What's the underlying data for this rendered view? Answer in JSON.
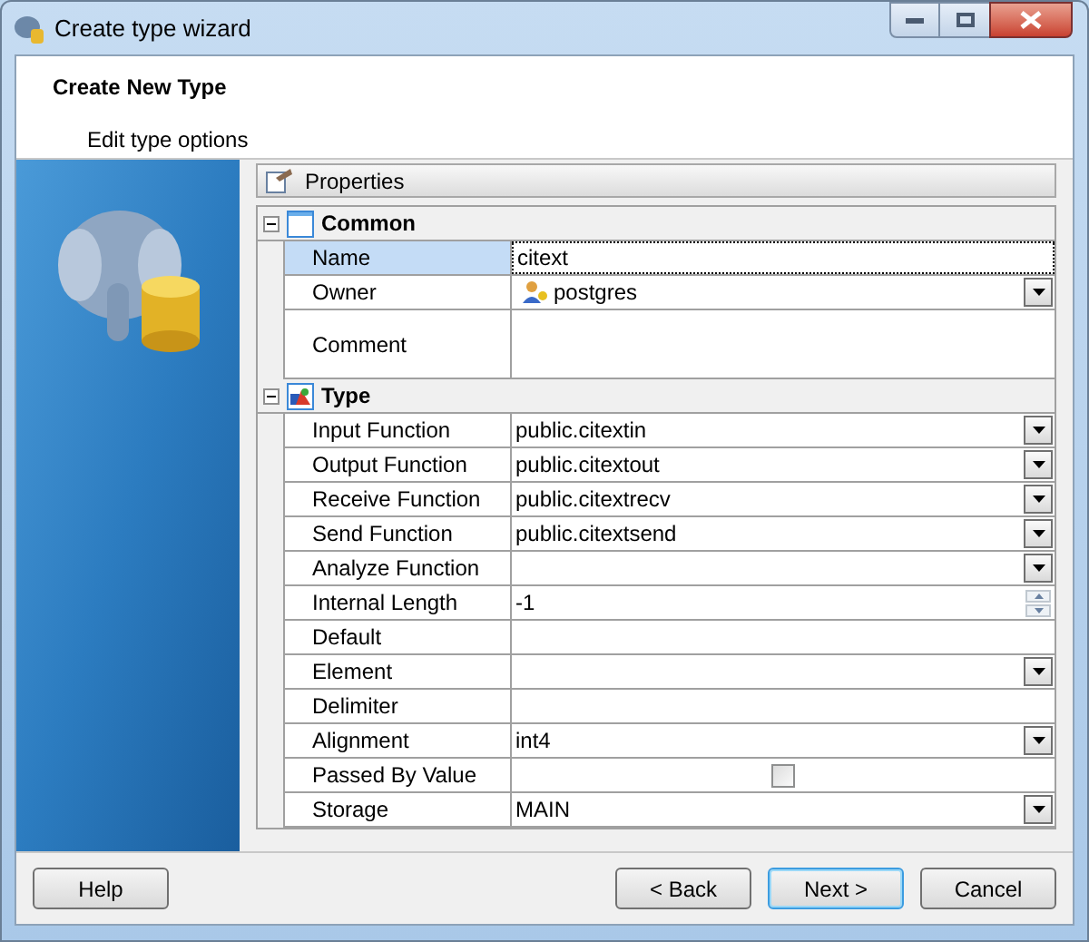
{
  "window": {
    "title": "Create type wizard"
  },
  "header": {
    "title": "Create New Type",
    "subtitle": "Edit type options"
  },
  "panel": {
    "title": "Properties"
  },
  "groups": [
    {
      "title": "Common",
      "expanded": true,
      "kind": "common",
      "rows": [
        {
          "label": "Name",
          "value": "citext",
          "kind": "text",
          "selected": true
        },
        {
          "label": "Owner",
          "value": "postgres",
          "kind": "owner",
          "selected": false
        },
        {
          "label": "Comment",
          "kind": "memo",
          "selected": false
        }
      ]
    },
    {
      "title": "Type",
      "expanded": true,
      "kind": "type",
      "rows": [
        {
          "label": "Input Function",
          "value": "public.citextin",
          "kind": "dropdown",
          "selected": false
        },
        {
          "label": "Output Function",
          "value": "public.citextout",
          "kind": "dropdown",
          "selected": false
        },
        {
          "label": "Receive Function",
          "value": "public.citextrecv",
          "kind": "dropdown",
          "selected": false
        },
        {
          "label": "Send Function",
          "value": "public.citextsend",
          "kind": "dropdown",
          "selected": false
        },
        {
          "label": "Analyze Function",
          "kind": "dropdown",
          "selected": false
        },
        {
          "label": "Internal Length",
          "value": "-1",
          "kind": "spin",
          "selected": false
        },
        {
          "label": "Default",
          "kind": "text",
          "selected": false
        },
        {
          "label": "Element",
          "kind": "dropdown",
          "selected": false
        },
        {
          "label": "Delimiter",
          "kind": "text",
          "selected": false
        },
        {
          "label": "Alignment",
          "value": "int4",
          "kind": "dropdown",
          "selected": false
        },
        {
          "label": "Passed By Value",
          "kind": "checkbox",
          "checked": false,
          "selected": false
        },
        {
          "label": "Storage",
          "value": "MAIN",
          "kind": "dropdown",
          "selected": false
        }
      ]
    }
  ],
  "buttons": [
    {
      "label": "Help",
      "kind": "left",
      "default": false
    },
    {
      "label": "< Back",
      "kind": "right",
      "default": false
    },
    {
      "label": "Next >",
      "kind": "right",
      "default": true
    },
    {
      "label": "Cancel",
      "kind": "right",
      "default": false
    }
  ]
}
